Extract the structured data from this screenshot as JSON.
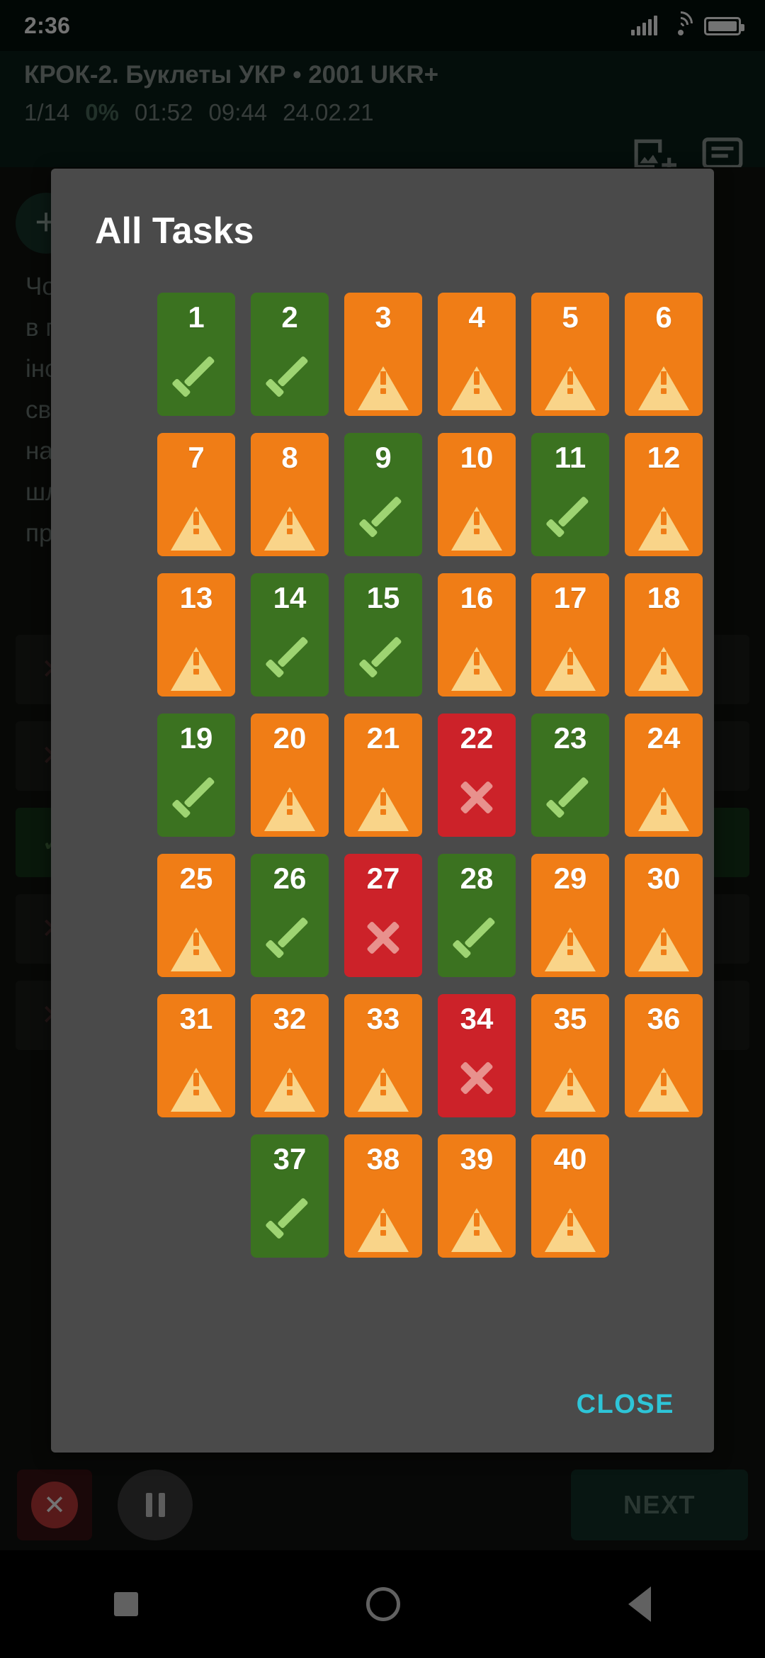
{
  "status_bar": {
    "clock": "2:36",
    "icons": [
      "signal-icon",
      "wifi-icon",
      "battery-icon"
    ]
  },
  "header": {
    "title": "КРОК-2. Буклеты УКР • 2001 UKR+",
    "stats": {
      "progress": "1/14",
      "percent": "0%",
      "elapsed": "01:52",
      "remaining": "09:44",
      "date": "24.02.21"
    },
    "actions": [
      {
        "name": "add-image-icon",
        "label": ""
      },
      {
        "name": "notes-icon",
        "label": ""
      }
    ]
  },
  "page_behind": {
    "fab_label": "+",
    "question": "Чо\nв п\nіно\nсв\nна\nшл\nпр"
  },
  "dialog": {
    "title": "All Tasks",
    "close_label": "CLOSE",
    "colors": {
      "ok": "#3b7220",
      "warn": "#f07d16",
      "bad": "#cc2229",
      "check": "#9ed472",
      "cross": "#e8918d",
      "warn_glyph": "#f9d489",
      "surface": "#4a4a4a",
      "accent": "#2ec5d8"
    },
    "columns": 6,
    "tasks": [
      {
        "n": "1",
        "status": "ok",
        "icon": "check-icon"
      },
      {
        "n": "2",
        "status": "ok",
        "icon": "check-icon"
      },
      {
        "n": "3",
        "status": "warn",
        "icon": "warning-icon"
      },
      {
        "n": "4",
        "status": "warn",
        "icon": "warning-icon"
      },
      {
        "n": "5",
        "status": "warn",
        "icon": "warning-icon"
      },
      {
        "n": "6",
        "status": "warn",
        "icon": "warning-icon"
      },
      {
        "n": "7",
        "status": "warn",
        "icon": "warning-icon"
      },
      {
        "n": "8",
        "status": "warn",
        "icon": "warning-icon"
      },
      {
        "n": "9",
        "status": "ok",
        "icon": "check-icon"
      },
      {
        "n": "10",
        "status": "warn",
        "icon": "warning-icon"
      },
      {
        "n": "11",
        "status": "ok",
        "icon": "check-icon"
      },
      {
        "n": "12",
        "status": "warn",
        "icon": "warning-icon"
      },
      {
        "n": "13",
        "status": "warn",
        "icon": "warning-icon"
      },
      {
        "n": "14",
        "status": "ok",
        "icon": "check-icon"
      },
      {
        "n": "15",
        "status": "ok",
        "icon": "check-icon"
      },
      {
        "n": "16",
        "status": "warn",
        "icon": "warning-icon"
      },
      {
        "n": "17",
        "status": "warn",
        "icon": "warning-icon"
      },
      {
        "n": "18",
        "status": "warn",
        "icon": "warning-icon"
      },
      {
        "n": "19",
        "status": "ok",
        "icon": "check-icon"
      },
      {
        "n": "20",
        "status": "warn",
        "icon": "warning-icon"
      },
      {
        "n": "21",
        "status": "warn",
        "icon": "warning-icon"
      },
      {
        "n": "22",
        "status": "bad",
        "icon": "cross-icon"
      },
      {
        "n": "23",
        "status": "ok",
        "icon": "check-icon"
      },
      {
        "n": "24",
        "status": "warn",
        "icon": "warning-icon"
      },
      {
        "n": "25",
        "status": "warn",
        "icon": "warning-icon"
      },
      {
        "n": "26",
        "status": "ok",
        "icon": "check-icon"
      },
      {
        "n": "27",
        "status": "bad",
        "icon": "cross-icon"
      },
      {
        "n": "28",
        "status": "ok",
        "icon": "check-icon"
      },
      {
        "n": "29",
        "status": "warn",
        "icon": "warning-icon"
      },
      {
        "n": "30",
        "status": "warn",
        "icon": "warning-icon"
      },
      {
        "n": "31",
        "status": "warn",
        "icon": "warning-icon"
      },
      {
        "n": "32",
        "status": "warn",
        "icon": "warning-icon"
      },
      {
        "n": "33",
        "status": "warn",
        "icon": "warning-icon"
      },
      {
        "n": "34",
        "status": "bad",
        "icon": "cross-icon"
      },
      {
        "n": "35",
        "status": "warn",
        "icon": "warning-icon"
      },
      {
        "n": "36",
        "status": "warn",
        "icon": "warning-icon"
      },
      {
        "n": "37",
        "status": "ok",
        "icon": "check-icon",
        "col": 2
      },
      {
        "n": "38",
        "status": "warn",
        "icon": "warning-icon"
      },
      {
        "n": "39",
        "status": "warn",
        "icon": "warning-icon"
      },
      {
        "n": "40",
        "status": "warn",
        "icon": "warning-icon"
      }
    ]
  },
  "controls": {
    "stop_label": "",
    "pause_label": "",
    "grid_label": "",
    "next_label": "NEXT"
  },
  "navbar": {
    "recents": "square-icon",
    "home": "circle-icon",
    "back": "triangle-icon"
  }
}
